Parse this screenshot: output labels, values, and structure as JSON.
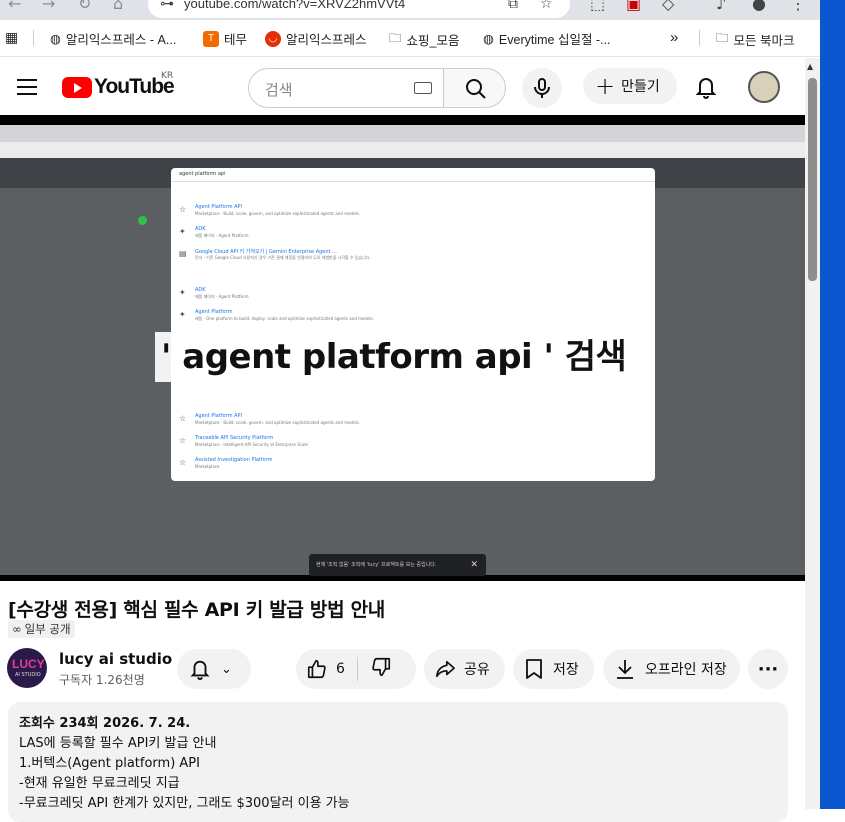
{
  "browser": {
    "url": "youtube.com/watch?v=XRVZ2hmVVt4",
    "bookmarks": [
      {
        "label": "알리익스프레스 - A...",
        "icon": "globe-icon"
      },
      {
        "label": "테무",
        "icon": "temu-icon",
        "color": "#f56a00"
      },
      {
        "label": "알리익스프레스",
        "icon": "aliexpress-icon",
        "color": "#e62e04"
      },
      {
        "label": "쇼핑_모음",
        "icon": "folder-icon"
      },
      {
        "label": "Everytime 십일절 -...",
        "icon": "globe-icon"
      }
    ],
    "more_bookmarks": "»",
    "all_bookmarks": "모든 북마크"
  },
  "header": {
    "logo_text": "YouTube",
    "logo_region": "KR",
    "search_placeholder": "검색",
    "create_label": "만들기"
  },
  "video": {
    "overlay_caption": "' agent platform api ' 검색",
    "search_query": "agent platform api",
    "dropdown_items": [
      {
        "title": "Agent Platform API",
        "sub": "Marketplace · Build, scale, govern, and optimize sophisticated agents and models."
      },
      {
        "title": "ADK",
        "sub": "제품 페이지 · Agent Platform"
      },
      {
        "title": "Google Cloud API 키 가져오기 | Gemini Enterprise Agent ...",
        "sub": "문서 · 기존 Google Cloud 사용자인 경우 기존 결제 계정을 연결하여 무료 체험판을 시작할 수 있습니다."
      },
      {
        "title": "ADK",
        "sub": "제품 페이지 · Agent Platform"
      },
      {
        "title": "Agent Platform",
        "sub": "제품 · One platform to build, deploy, scale and optimize sophisticated agents and models."
      },
      {
        "title": "Agent Platform API",
        "sub": "Marketplace · Build, scale, govern, and optimize sophisticated agents and models."
      },
      {
        "title": "Traceable API Security Platform",
        "sub": "Marketplace · Intelligent API Security at Enterprise Scale"
      },
      {
        "title": "Assisted Investigation Platform",
        "sub": "Marketplace"
      }
    ],
    "toast": "현재 '조직 없음' 조직에 'lucy' 프로젝트를 보는 중입니다."
  },
  "meta": {
    "title": "[수강생 전용] 핵심 필수 API 키 발급 방법 안내",
    "visibility": "일부 공개",
    "channel_name": "lucy ai studio",
    "channel_avatar_text": "LUCY",
    "channel_avatar_sub": "AI STUDIO",
    "subscribers": "구독자 1.26천명",
    "likes": "6",
    "share_label": "공유",
    "save_label": "저장",
    "offline_label": "오프라인 저장"
  },
  "description": {
    "views_date": "조회수 234회  2026. 7. 24.",
    "lines": [
      "LAS에 등록할 필수 API키 발급 안내",
      "1.버텍스(Agent platform) API",
      "-현재 유일한 무료크레딧 지급",
      "-무료크레딧 API 한계가 있지만, 그래도 $300달러 이용 가능"
    ]
  }
}
